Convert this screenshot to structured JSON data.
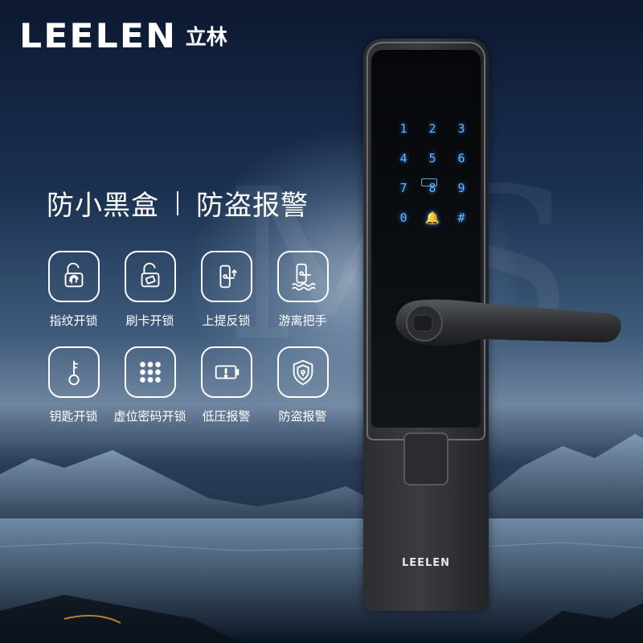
{
  "brand": {
    "name": "LEELEN",
    "name_cn": "立林"
  },
  "headline": {
    "left": "防小黑盒",
    "right": "防盗报警"
  },
  "features": [
    {
      "icon": "fingerprint-unlock-icon",
      "label": "指纹开锁"
    },
    {
      "icon": "card-unlock-icon",
      "label": "刷卡开锁"
    },
    {
      "icon": "lift-lock-icon",
      "label": "上提反锁"
    },
    {
      "icon": "floating-handle-icon",
      "label": "游离把手"
    },
    {
      "icon": "key-icon",
      "label": "钥匙开锁"
    },
    {
      "icon": "keypad-icon",
      "label": "虚位密码开锁"
    },
    {
      "icon": "low-battery-icon",
      "label": "低压报警"
    },
    {
      "icon": "shield-icon",
      "label": "防盗报警"
    }
  ],
  "lock": {
    "keypad": [
      "1",
      "2",
      "3",
      "4",
      "5",
      "6",
      "7",
      "8",
      "9",
      "0",
      "🔔",
      "#"
    ],
    "card_label": "CARD",
    "brand": "LEELEN"
  },
  "colors": {
    "keypad_glow": "#5fb5ff",
    "text": "#ffffff"
  }
}
